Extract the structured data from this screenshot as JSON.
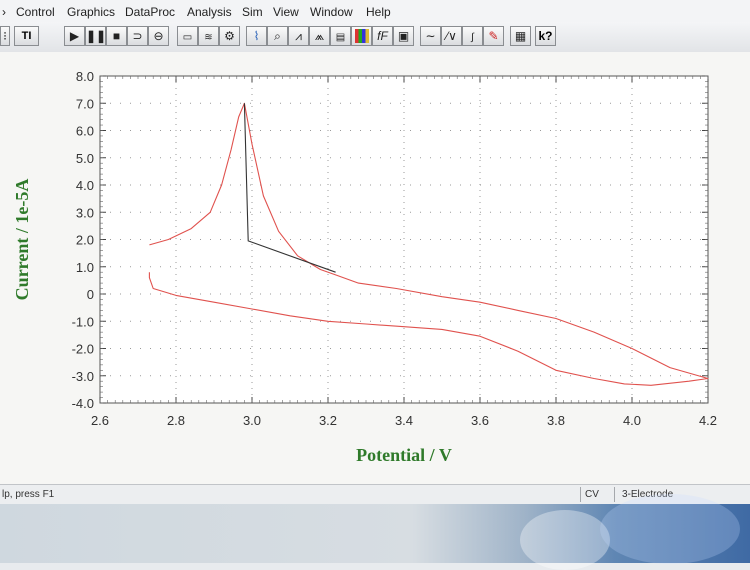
{
  "menu": {
    "items": [
      "Control",
      "Graphics",
      "DataProc",
      "Analysis",
      "Sim",
      "View",
      "Window",
      "Help"
    ]
  },
  "toolbar": {
    "buttons": [
      {
        "icon": "ti-icon"
      },
      {
        "icon": "play-icon"
      },
      {
        "icon": "pause-icon"
      },
      {
        "icon": "stop-icon"
      },
      {
        "icon": "reverse-icon"
      },
      {
        "icon": "filter-icon"
      },
      {
        "icon": "parameters-icon"
      },
      {
        "icon": "special-plot-icon"
      },
      {
        "icon": "graph-icon"
      },
      {
        "icon": "zoom-icon"
      },
      {
        "icon": "peak-icon"
      },
      {
        "icon": "peak-find-icon"
      },
      {
        "icon": "overlay-icon"
      },
      {
        "icon": "color-icon"
      },
      {
        "icon": "fp-icon"
      },
      {
        "icon": "print-icon"
      },
      {
        "icon": "smooth-icon"
      },
      {
        "icon": "derivative-icon"
      },
      {
        "icon": "integrate-icon"
      },
      {
        "icon": "pen-icon"
      },
      {
        "icon": "notes-icon"
      },
      {
        "icon": "help-cursor-icon"
      }
    ],
    "labels": {
      "ti": "TI",
      "fp": "fF",
      "help": "k?"
    }
  },
  "status": {
    "left": "lp, press F1",
    "mode": "CV",
    "electrode": "3-Electrode"
  },
  "chart_data": {
    "type": "line",
    "xlabel": "Potential / V",
    "ylabel": "Current / 1e-5A",
    "xlim": [
      2.6,
      4.2
    ],
    "ylim": [
      -4.0,
      8.0
    ],
    "x_ticks": [
      "2.6",
      "2.8",
      "3.0",
      "3.2",
      "3.4",
      "3.6",
      "3.8",
      "4.0",
      "4.2"
    ],
    "y_ticks": [
      "8.0",
      "7.0",
      "6.0",
      "5.0",
      "4.0",
      "3.0",
      "2.0",
      "1.0",
      "0",
      "-1.0",
      "-2.0",
      "-3.0",
      "-4.0"
    ],
    "grid": true,
    "series": [
      {
        "color": "#e0524e",
        "x": [
          2.73,
          2.78,
          2.84,
          2.89,
          2.92,
          2.945,
          2.965,
          2.98,
          3.0,
          3.03,
          3.07,
          3.12,
          3.18,
          3.22,
          3.28,
          3.38,
          3.5,
          3.6,
          3.7,
          3.8,
          3.9,
          4.0,
          4.1,
          4.2,
          4.15,
          4.05,
          3.98,
          3.9,
          3.8,
          3.7,
          3.6,
          3.5,
          3.4,
          3.3,
          3.2,
          3.1,
          3.0,
          2.9,
          2.8,
          2.74,
          2.73,
          2.73
        ],
        "y": [
          1.8,
          2.0,
          2.4,
          3.0,
          4.0,
          5.3,
          6.5,
          7.0,
          5.5,
          3.6,
          2.3,
          1.4,
          0.9,
          0.7,
          0.4,
          0.2,
          -0.1,
          -0.3,
          -0.6,
          -0.9,
          -1.4,
          -2.0,
          -2.7,
          -3.1,
          -3.2,
          -3.35,
          -3.3,
          -3.1,
          -2.8,
          -2.1,
          -1.55,
          -1.3,
          -1.2,
          -1.1,
          -1.0,
          -0.8,
          -0.55,
          -0.3,
          -0.05,
          0.2,
          0.6,
          0.8
        ]
      }
    ],
    "annotations": [
      {
        "type": "baseline",
        "color": "#333333",
        "x": [
          2.98,
          2.99,
          3.22
        ],
        "y": [
          7.0,
          1.95,
          0.8
        ]
      }
    ]
  }
}
